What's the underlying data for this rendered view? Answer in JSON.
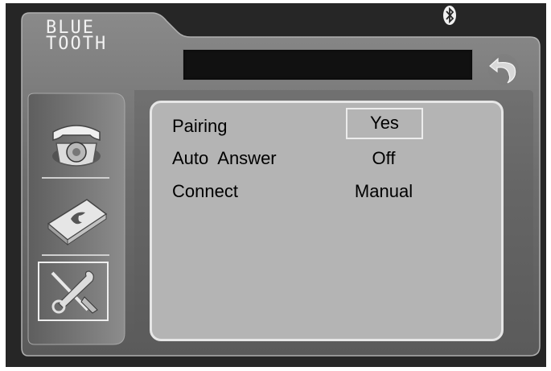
{
  "app": {
    "brand_line1": "BLUE",
    "brand_line2": "TOOTH",
    "title_bar_text": ""
  },
  "sidebar": {
    "items": [
      {
        "id": "phone",
        "icon": "telephone-icon",
        "selected": false
      },
      {
        "id": "phonebook",
        "icon": "phonebook-icon",
        "selected": false
      },
      {
        "id": "settings",
        "icon": "tools-icon",
        "selected": true
      }
    ]
  },
  "settings": {
    "rows": [
      {
        "label": "Pairing",
        "value": "Yes"
      },
      {
        "label": "Auto  Answer",
        "value": "Off"
      },
      {
        "label": "Connect",
        "value": "Manual"
      }
    ]
  },
  "icons": {
    "status": "bluetooth-icon",
    "back": "back-arrow-icon"
  },
  "colors": {
    "background": "#262626",
    "frame": "#707070",
    "panel": "#b4b4b4",
    "text_light": "#f2f2f2"
  }
}
